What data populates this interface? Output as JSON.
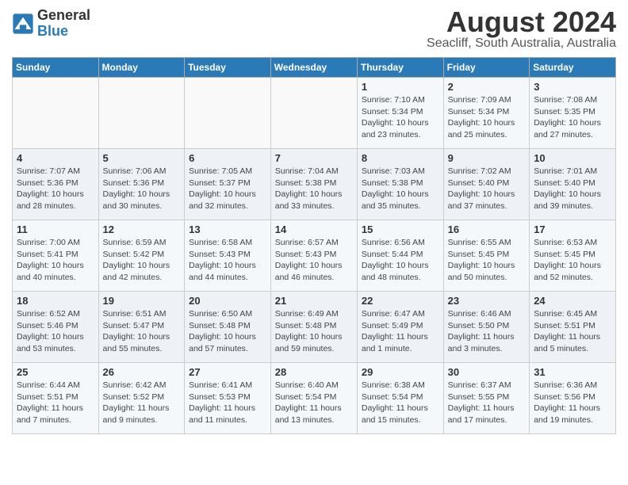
{
  "logo": {
    "text_general": "General",
    "text_blue": "Blue"
  },
  "title": "August 2024",
  "subtitle": "Seacliff, South Australia, Australia",
  "days_of_week": [
    "Sunday",
    "Monday",
    "Tuesday",
    "Wednesday",
    "Thursday",
    "Friday",
    "Saturday"
  ],
  "weeks": [
    [
      {
        "day": "",
        "sunrise": "",
        "sunset": "",
        "daylight": ""
      },
      {
        "day": "",
        "sunrise": "",
        "sunset": "",
        "daylight": ""
      },
      {
        "day": "",
        "sunrise": "",
        "sunset": "",
        "daylight": ""
      },
      {
        "day": "",
        "sunrise": "",
        "sunset": "",
        "daylight": ""
      },
      {
        "day": "1",
        "sunrise": "Sunrise: 7:10 AM",
        "sunset": "Sunset: 5:34 PM",
        "daylight": "Daylight: 10 hours and 23 minutes."
      },
      {
        "day": "2",
        "sunrise": "Sunrise: 7:09 AM",
        "sunset": "Sunset: 5:34 PM",
        "daylight": "Daylight: 10 hours and 25 minutes."
      },
      {
        "day": "3",
        "sunrise": "Sunrise: 7:08 AM",
        "sunset": "Sunset: 5:35 PM",
        "daylight": "Daylight: 10 hours and 27 minutes."
      }
    ],
    [
      {
        "day": "4",
        "sunrise": "Sunrise: 7:07 AM",
        "sunset": "Sunset: 5:36 PM",
        "daylight": "Daylight: 10 hours and 28 minutes."
      },
      {
        "day": "5",
        "sunrise": "Sunrise: 7:06 AM",
        "sunset": "Sunset: 5:36 PM",
        "daylight": "Daylight: 10 hours and 30 minutes."
      },
      {
        "day": "6",
        "sunrise": "Sunrise: 7:05 AM",
        "sunset": "Sunset: 5:37 PM",
        "daylight": "Daylight: 10 hours and 32 minutes."
      },
      {
        "day": "7",
        "sunrise": "Sunrise: 7:04 AM",
        "sunset": "Sunset: 5:38 PM",
        "daylight": "Daylight: 10 hours and 33 minutes."
      },
      {
        "day": "8",
        "sunrise": "Sunrise: 7:03 AM",
        "sunset": "Sunset: 5:38 PM",
        "daylight": "Daylight: 10 hours and 35 minutes."
      },
      {
        "day": "9",
        "sunrise": "Sunrise: 7:02 AM",
        "sunset": "Sunset: 5:40 PM",
        "daylight": "Daylight: 10 hours and 37 minutes."
      },
      {
        "day": "10",
        "sunrise": "Sunrise: 7:01 AM",
        "sunset": "Sunset: 5:40 PM",
        "daylight": "Daylight: 10 hours and 39 minutes."
      }
    ],
    [
      {
        "day": "11",
        "sunrise": "Sunrise: 7:00 AM",
        "sunset": "Sunset: 5:41 PM",
        "daylight": "Daylight: 10 hours and 40 minutes."
      },
      {
        "day": "12",
        "sunrise": "Sunrise: 6:59 AM",
        "sunset": "Sunset: 5:42 PM",
        "daylight": "Daylight: 10 hours and 42 minutes."
      },
      {
        "day": "13",
        "sunrise": "Sunrise: 6:58 AM",
        "sunset": "Sunset: 5:43 PM",
        "daylight": "Daylight: 10 hours and 44 minutes."
      },
      {
        "day": "14",
        "sunrise": "Sunrise: 6:57 AM",
        "sunset": "Sunset: 5:43 PM",
        "daylight": "Daylight: 10 hours and 46 minutes."
      },
      {
        "day": "15",
        "sunrise": "Sunrise: 6:56 AM",
        "sunset": "Sunset: 5:44 PM",
        "daylight": "Daylight: 10 hours and 48 minutes."
      },
      {
        "day": "16",
        "sunrise": "Sunrise: 6:55 AM",
        "sunset": "Sunset: 5:45 PM",
        "daylight": "Daylight: 10 hours and 50 minutes."
      },
      {
        "day": "17",
        "sunrise": "Sunrise: 6:53 AM",
        "sunset": "Sunset: 5:45 PM",
        "daylight": "Daylight: 10 hours and 52 minutes."
      }
    ],
    [
      {
        "day": "18",
        "sunrise": "Sunrise: 6:52 AM",
        "sunset": "Sunset: 5:46 PM",
        "daylight": "Daylight: 10 hours and 53 minutes."
      },
      {
        "day": "19",
        "sunrise": "Sunrise: 6:51 AM",
        "sunset": "Sunset: 5:47 PM",
        "daylight": "Daylight: 10 hours and 55 minutes."
      },
      {
        "day": "20",
        "sunrise": "Sunrise: 6:50 AM",
        "sunset": "Sunset: 5:48 PM",
        "daylight": "Daylight: 10 hours and 57 minutes."
      },
      {
        "day": "21",
        "sunrise": "Sunrise: 6:49 AM",
        "sunset": "Sunset: 5:48 PM",
        "daylight": "Daylight: 10 hours and 59 minutes."
      },
      {
        "day": "22",
        "sunrise": "Sunrise: 6:47 AM",
        "sunset": "Sunset: 5:49 PM",
        "daylight": "Daylight: 11 hours and 1 minute."
      },
      {
        "day": "23",
        "sunrise": "Sunrise: 6:46 AM",
        "sunset": "Sunset: 5:50 PM",
        "daylight": "Daylight: 11 hours and 3 minutes."
      },
      {
        "day": "24",
        "sunrise": "Sunrise: 6:45 AM",
        "sunset": "Sunset: 5:51 PM",
        "daylight": "Daylight: 11 hours and 5 minutes."
      }
    ],
    [
      {
        "day": "25",
        "sunrise": "Sunrise: 6:44 AM",
        "sunset": "Sunset: 5:51 PM",
        "daylight": "Daylight: 11 hours and 7 minutes."
      },
      {
        "day": "26",
        "sunrise": "Sunrise: 6:42 AM",
        "sunset": "Sunset: 5:52 PM",
        "daylight": "Daylight: 11 hours and 9 minutes."
      },
      {
        "day": "27",
        "sunrise": "Sunrise: 6:41 AM",
        "sunset": "Sunset: 5:53 PM",
        "daylight": "Daylight: 11 hours and 11 minutes."
      },
      {
        "day": "28",
        "sunrise": "Sunrise: 6:40 AM",
        "sunset": "Sunset: 5:54 PM",
        "daylight": "Daylight: 11 hours and 13 minutes."
      },
      {
        "day": "29",
        "sunrise": "Sunrise: 6:38 AM",
        "sunset": "Sunset: 5:54 PM",
        "daylight": "Daylight: 11 hours and 15 minutes."
      },
      {
        "day": "30",
        "sunrise": "Sunrise: 6:37 AM",
        "sunset": "Sunset: 5:55 PM",
        "daylight": "Daylight: 11 hours and 17 minutes."
      },
      {
        "day": "31",
        "sunrise": "Sunrise: 6:36 AM",
        "sunset": "Sunset: 5:56 PM",
        "daylight": "Daylight: 11 hours and 19 minutes."
      }
    ]
  ]
}
